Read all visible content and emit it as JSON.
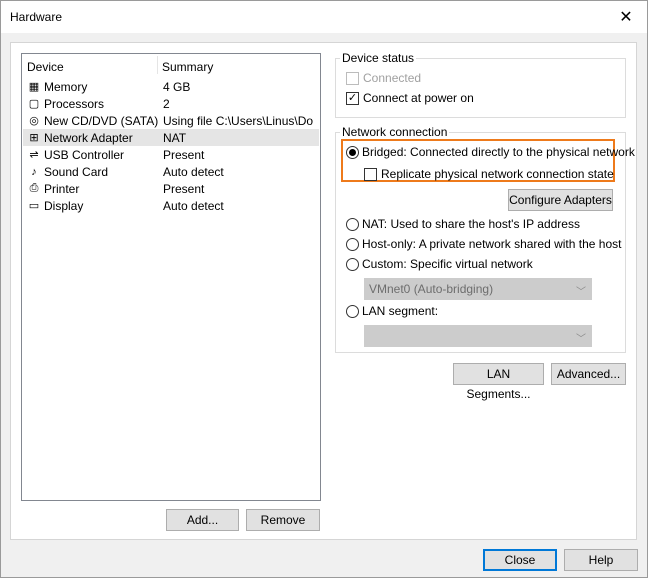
{
  "window": {
    "title": "Hardware",
    "close_glyph": "✕"
  },
  "device_list": {
    "columns": {
      "device": "Device",
      "summary": "Summary"
    },
    "rows": [
      {
        "icon": "memory-icon",
        "name": "Memory",
        "summary": "4 GB",
        "glyph": "▦"
      },
      {
        "icon": "processor-icon",
        "name": "Processors",
        "summary": "2",
        "glyph": "▢"
      },
      {
        "icon": "cd-dvd-icon",
        "name": "New CD/DVD (SATA)",
        "summary": "Using file C:\\Users\\Linus\\Do...",
        "glyph": "◎"
      },
      {
        "icon": "network-adapter-icon",
        "name": "Network Adapter",
        "summary": "NAT",
        "glyph": "⊞"
      },
      {
        "icon": "usb-icon",
        "name": "USB Controller",
        "summary": "Present",
        "glyph": "⇌"
      },
      {
        "icon": "sound-card-icon",
        "name": "Sound Card",
        "summary": "Auto detect",
        "glyph": "♪"
      },
      {
        "icon": "printer-icon",
        "name": "Printer",
        "summary": "Present",
        "glyph": "⎙"
      },
      {
        "icon": "display-icon",
        "name": "Display",
        "summary": "Auto detect",
        "glyph": "▭"
      }
    ],
    "selected_index": 3
  },
  "buttons": {
    "add": "Add...",
    "remove": "Remove",
    "configure_adapters": "Configure Adapters",
    "lan_segments": "LAN Segments...",
    "advanced": "Advanced...",
    "close": "Close",
    "help": "Help"
  },
  "device_status": {
    "label": "Device status",
    "connected": {
      "label": "Connected",
      "checked": false,
      "enabled": false
    },
    "connect_at_power_on": {
      "label": "Connect at power on",
      "checked": true,
      "enabled": true
    }
  },
  "network_connection": {
    "label": "Network connection",
    "bridged": {
      "label": "Bridged: Connected directly to the physical network",
      "selected": true
    },
    "replicate": {
      "label": "Replicate physical network connection state",
      "checked": false
    },
    "nat": {
      "label": "NAT: Used to share the host's IP address",
      "selected": false
    },
    "host_only": {
      "label": "Host-only: A private network shared with the host",
      "selected": false
    },
    "custom": {
      "label": "Custom: Specific virtual network",
      "selected": false
    },
    "custom_select_value": "VMnet0 (Auto-bridging)",
    "lan_segment": {
      "label": "LAN segment:",
      "selected": false
    },
    "lan_select_value": ""
  },
  "colors": {
    "highlight": "#ee7a1b",
    "default_button_border": "#0078d7"
  }
}
